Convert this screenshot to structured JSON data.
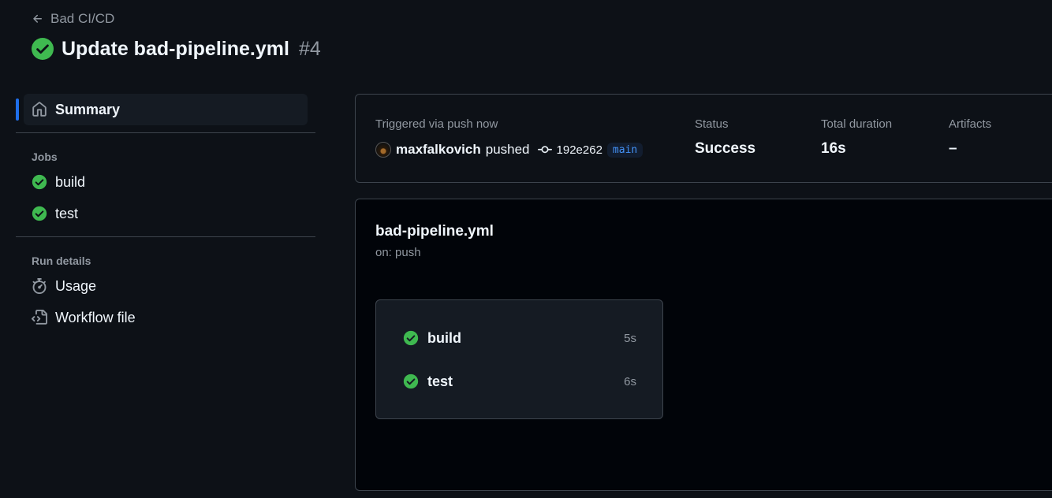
{
  "header": {
    "back_label": "Bad CI/CD",
    "title": "Update bad-pipeline.yml",
    "run_number": "#4"
  },
  "sidebar": {
    "summary_label": "Summary",
    "jobs_heading": "Jobs",
    "jobs": [
      {
        "label": "build",
        "status": "success"
      },
      {
        "label": "test",
        "status": "success"
      }
    ],
    "run_details_heading": "Run details",
    "details": [
      {
        "label": "Usage",
        "icon": "stopwatch-icon"
      },
      {
        "label": "Workflow file",
        "icon": "file-code-icon"
      }
    ]
  },
  "summary": {
    "trigger_label": "Triggered via push now",
    "actor": "maxfalkovich",
    "action": "pushed",
    "commit_sha": "192e262",
    "branch": "main",
    "status_label": "Status",
    "status_value": "Success",
    "duration_label": "Total duration",
    "duration_value": "16s",
    "artifacts_label": "Artifacts",
    "artifacts_value": "–"
  },
  "workflow": {
    "name": "bad-pipeline.yml",
    "trigger": "on: push",
    "jobs": [
      {
        "name": "build",
        "duration": "5s",
        "status": "success"
      },
      {
        "name": "test",
        "duration": "6s",
        "status": "success"
      }
    ]
  },
  "colors": {
    "success": "#3fb950",
    "accent": "#1f6feb",
    "link": "#4493f8",
    "background": "#0d1117"
  }
}
